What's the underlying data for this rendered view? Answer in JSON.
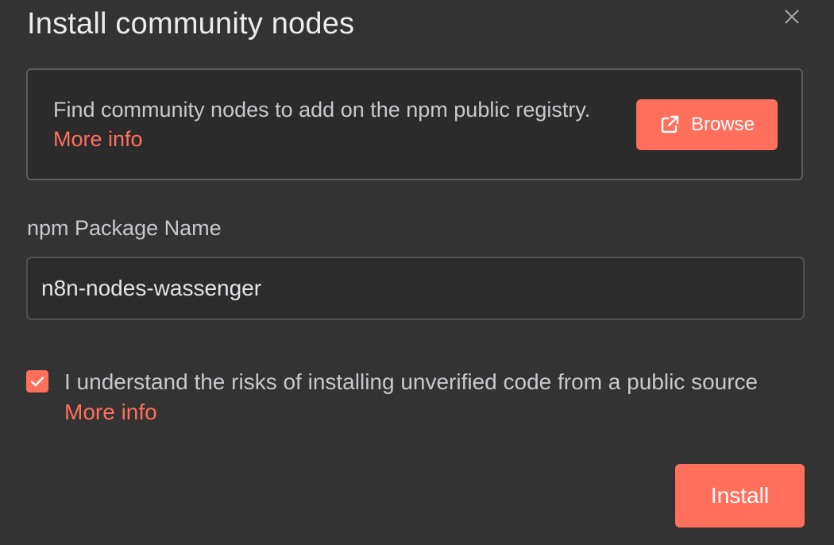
{
  "dialog": {
    "title": "Install community nodes",
    "close_icon": "close-icon"
  },
  "info_box": {
    "text": "Find community nodes to add on the npm public registry.",
    "more_info_label": "More info",
    "browse_label": "Browse",
    "browse_icon": "external-link-icon"
  },
  "package_field": {
    "label": "npm Package Name",
    "value": "n8n-nodes-wassenger"
  },
  "risk_checkbox": {
    "checked": true,
    "label": "I understand the risks of installing unverified code from a public source",
    "more_info_label": "More info"
  },
  "footer": {
    "install_label": "Install"
  },
  "colors": {
    "accent": "#ff6f5c",
    "background": "#333333",
    "text": "#c8c9ce"
  }
}
